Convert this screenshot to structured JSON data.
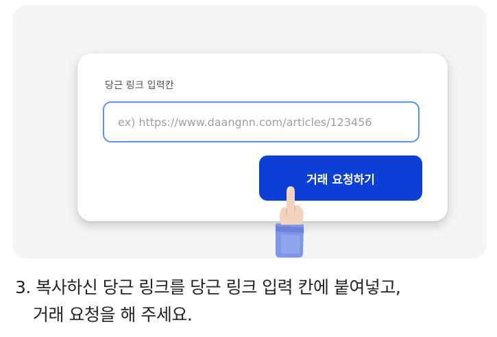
{
  "card": {
    "field_label": "당근 링크 입력칸",
    "input_placeholder": "ex) https://www.daangnn.com/articles/123456",
    "input_value": "",
    "button_label": "거래 요청하기"
  },
  "instruction": {
    "line1": "3. 복사하신 당근 링크를 당근 링크 입력 칸에 붙여넣고,",
    "line2": "거래 요청을 해 주세요."
  },
  "colors": {
    "button_bg": "#0b3fd6",
    "input_border": "#5b8ff9",
    "panel_bg": "#f4f5f7"
  },
  "icons": {
    "hand": "pointing-hand-icon"
  }
}
